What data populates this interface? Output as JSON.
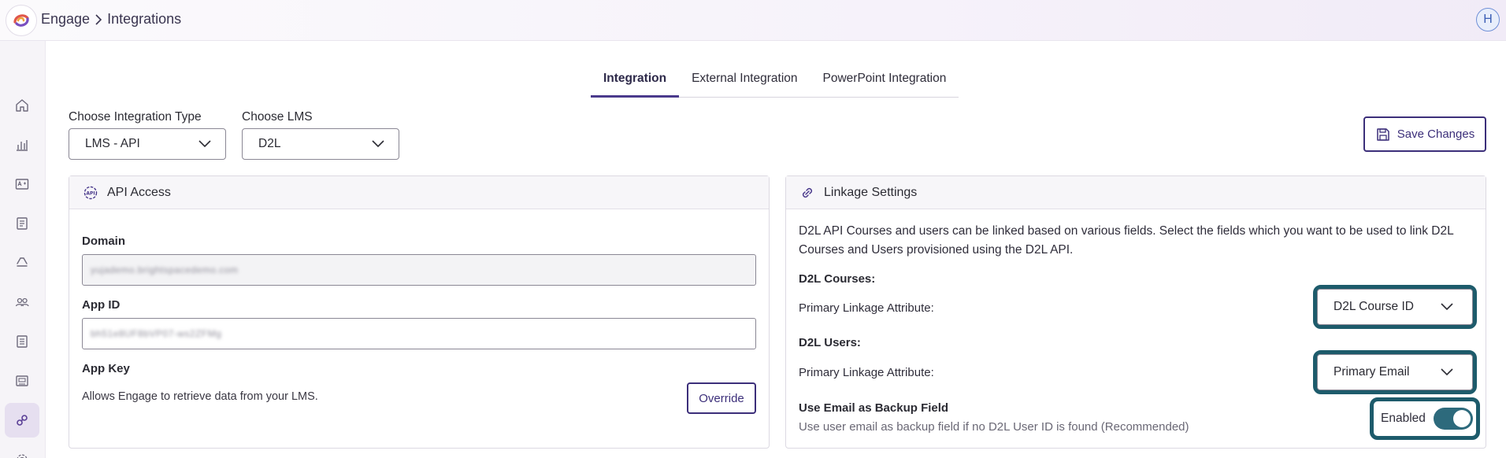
{
  "header": {
    "breadcrumb_root": "Engage",
    "breadcrumb_current": "Integrations",
    "user_initial": "H"
  },
  "sidebar": {
    "items": [
      {
        "icon": "home-icon"
      },
      {
        "icon": "bar-chart-icon"
      },
      {
        "icon": "grade-card-icon"
      },
      {
        "icon": "document-icon"
      },
      {
        "icon": "recycle-icon"
      },
      {
        "icon": "users-icon"
      },
      {
        "icon": "list-icon"
      },
      {
        "icon": "id-card-icon"
      },
      {
        "icon": "integrations-icon",
        "active": true
      },
      {
        "icon": "settings-icon"
      }
    ]
  },
  "tabs": [
    {
      "label": "Integration",
      "active": true
    },
    {
      "label": "External Integration"
    },
    {
      "label": "PowerPoint Integration"
    }
  ],
  "filters": {
    "integration_type_label": "Choose Integration Type",
    "integration_type_value": "LMS - API",
    "lms_label": "Choose LMS",
    "lms_value": "D2L"
  },
  "save_label": "Save Changes",
  "api_access": {
    "title": "API Access",
    "domain_label": "Domain",
    "domain_value": "yujademo.brightspacedemo.com",
    "app_id_label": "App ID",
    "app_id_value": "bh51e8UF8bVP07-ws2ZFMg",
    "app_key_label": "App Key",
    "app_key_desc": "Allows Engage to retrieve data from your LMS.",
    "override_label": "Override"
  },
  "linkage": {
    "title": "Linkage Settings",
    "description": "D2L API Courses and users can be linked based on various fields. Select the fields which you want to be used to link D2L Courses and Users provisioned using the D2L API.",
    "courses_heading": "D2L Courses:",
    "courses_attr_label": "Primary Linkage Attribute:",
    "courses_attr_value": "D2L Course ID",
    "users_heading": "D2L Users:",
    "users_attr_label": "Primary Linkage Attribute:",
    "users_attr_value": "Primary Email",
    "backup_heading": "Use Email as Backup Field",
    "backup_desc": "Use user email as backup field if no D2L User ID is found (Recommended)",
    "toggle_label": "Enabled",
    "toggle_on": true
  },
  "colors": {
    "accent": "#3c2f7a",
    "highlight": "#1d5b6b",
    "toggle": "#2d6a7c"
  }
}
